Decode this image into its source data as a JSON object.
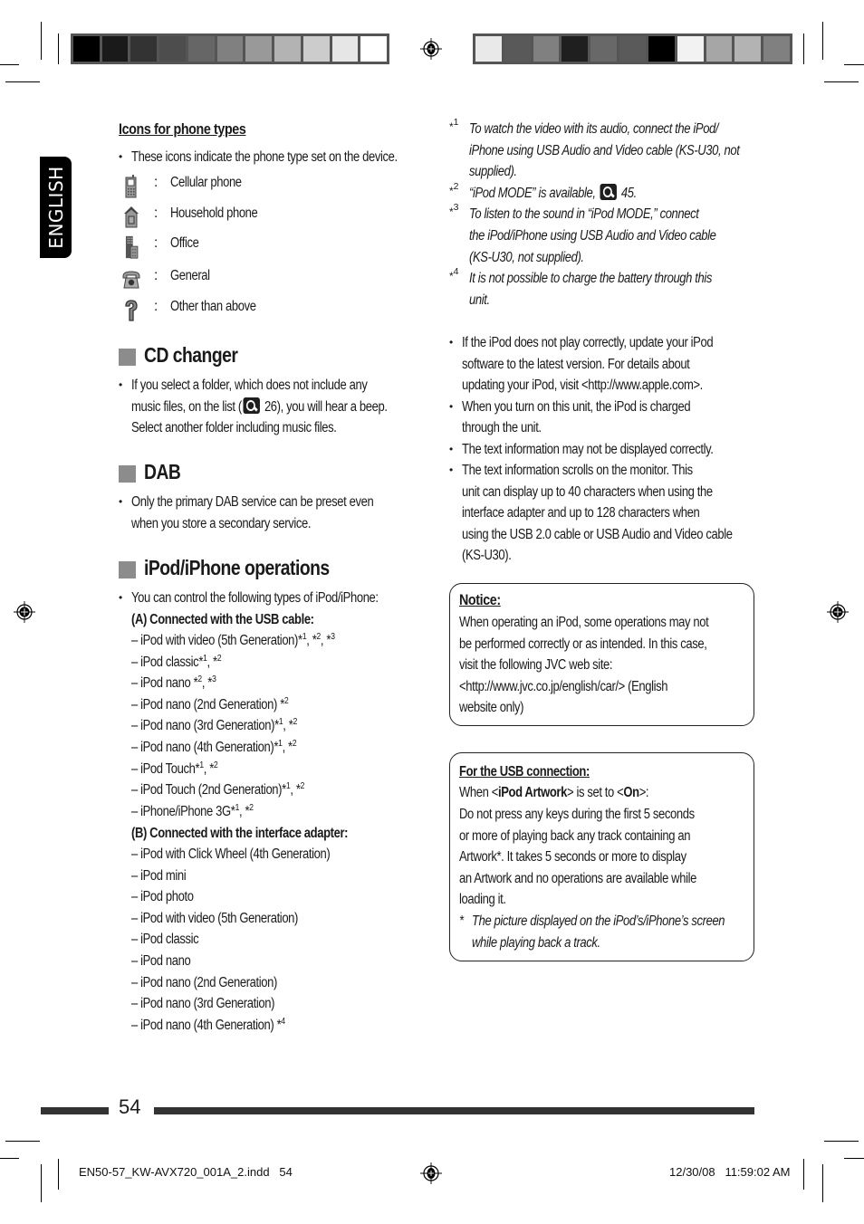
{
  "print_marks": {
    "colorbar_left": [
      "#000000",
      "#1a1a1a",
      "#333333",
      "#4d4d4d",
      "#666666",
      "#808080",
      "#999999",
      "#b3b3b3",
      "#cccccc",
      "#e6e6e6",
      "#ffffff"
    ],
    "colorbar_right": [
      "#e9e9e9",
      "#595959",
      "#808080",
      "#1f1f1f",
      "#686868",
      "#5a5a5a",
      "#000000",
      "#f2f2f2",
      "#a6a6a6",
      "#b3b3b3",
      "#808080"
    ]
  },
  "language_tab": "ENGLISH",
  "phone_icons": {
    "heading": "Icons for phone types",
    "intro": "These icons indicate the phone type set on the device.",
    "items": [
      {
        "icon": "cellular-phone-icon",
        "label": "Cellular phone"
      },
      {
        "icon": "household-phone-icon",
        "label": "Household phone"
      },
      {
        "icon": "office-icon",
        "label": "Office"
      },
      {
        "icon": "general-phone-icon",
        "label": "General"
      },
      {
        "icon": "question-mark-icon",
        "label": "Other than above"
      }
    ],
    "separator": ":"
  },
  "cd_changer": {
    "title": "CD changer",
    "line1": "If you select a folder, which does not include any",
    "line2_pre": "music files, on the list (",
    "line2_ref": "26",
    "line2_post": "), you will hear a beep.",
    "line3": "Select another folder including music files."
  },
  "dab": {
    "title": "DAB",
    "lines": [
      "Only the primary DAB service can be preset even",
      "when you store a secondary service."
    ]
  },
  "ipod": {
    "title": "iPod/iPhone operations",
    "intro": "You can control the following types of iPod/iPhone:",
    "group_a": {
      "label": "(A) Connected with the USB cable:",
      "items": [
        {
          "name": "iPod with video (5th Generation)",
          "notes": "*1, *2, *3"
        },
        {
          "name": "iPod classic",
          "notes": "*1, *2"
        },
        {
          "name": "iPod nano ",
          "notes": "*2, *3"
        },
        {
          "name": "iPod nano (2nd Generation) ",
          "notes": "*2"
        },
        {
          "name": "iPod nano (3rd Generation)",
          "notes": "*1, *2"
        },
        {
          "name": "iPod nano (4th Generation)",
          "notes": "*1, *2"
        },
        {
          "name": "iPod Touch",
          "notes": "*1, *2"
        },
        {
          "name": "iPod Touch (2nd Generation)",
          "notes": "*1, *2"
        },
        {
          "name": "iPhone/iPhone 3G",
          "notes": "*1, *2"
        }
      ]
    },
    "group_b": {
      "label": "(B) Connected with the interface adapter:",
      "items": [
        {
          "name": "iPod with Click Wheel (4th Generation)",
          "notes": ""
        },
        {
          "name": "iPod mini",
          "notes": ""
        },
        {
          "name": "iPod photo",
          "notes": ""
        },
        {
          "name": "iPod with video (5th Generation)",
          "notes": ""
        },
        {
          "name": "iPod classic",
          "notes": ""
        },
        {
          "name": "iPod nano",
          "notes": ""
        },
        {
          "name": "iPod nano (2nd Generation)",
          "notes": ""
        },
        {
          "name": "iPod nano (3rd Generation)",
          "notes": ""
        },
        {
          "name": "iPod nano (4th Generation) ",
          "notes": "*4"
        }
      ]
    },
    "dash": "–"
  },
  "footnotes": [
    {
      "mark": "*1",
      "lines": [
        "To watch the video with its audio, connect the iPod/",
        "iPhone using USB Audio and Video cable (KS-U30, not",
        "supplied)."
      ]
    },
    {
      "mark": "*2",
      "pre": "“iPod MODE” is available, ",
      "ref": "45."
    },
    {
      "mark": "*3",
      "lines": [
        "To listen to the sound in “iPod MODE,” connect",
        "the iPod/iPhone using USB Audio and Video cable",
        "(KS-U30, not supplied)."
      ]
    },
    {
      "mark": "*4",
      "lines": [
        "It is not possible to charge the battery through this",
        "unit."
      ]
    }
  ],
  "notes": [
    [
      "If the iPod does not play correctly, update your iPod",
      "software to the latest version. For details about",
      "updating your iPod, visit <http://www.apple.com>."
    ],
    [
      "When you turn on this unit, the iPod is charged",
      "through the unit."
    ],
    [
      "The text information may not be displayed correctly."
    ],
    [
      "The text information scrolls on the monitor. This",
      "unit can display up to 40 characters when using the",
      "interface adapter and up to 128 characters when",
      "using the USB 2.0 cable or USB Audio and Video cable",
      "(KS-U30)."
    ]
  ],
  "notice": {
    "title": "Notice:",
    "lines": [
      "When operating an iPod, some operations may not",
      "be performed correctly or as intended. In this case,",
      "visit the following JVC web site:",
      "<http://www.jvc.co.jp/english/car/> (English",
      "website only)"
    ]
  },
  "usb_box": {
    "title": "For the USB connection:",
    "when_pre": "When <",
    "when_setting": "iPod Artwork",
    "when_mid": "> is set to <",
    "when_value": "On",
    "when_post": ">:",
    "lines": [
      "Do not press any keys during the first 5 seconds",
      "or more of playing back any track containing an",
      "Artwork*. It takes 5 seconds or more to display",
      "an Artwork and no operations are available while",
      "loading it."
    ],
    "note_mark": "*",
    "note_lines": [
      "The picture displayed on the iPod’s/iPhone’s screen",
      "while playing back a track."
    ]
  },
  "page_number": "54",
  "slug": {
    "file": "EN50-57_KW-AVX720_001A_2.indd   54",
    "datetime": "12/30/08   11:59:02 AM"
  }
}
